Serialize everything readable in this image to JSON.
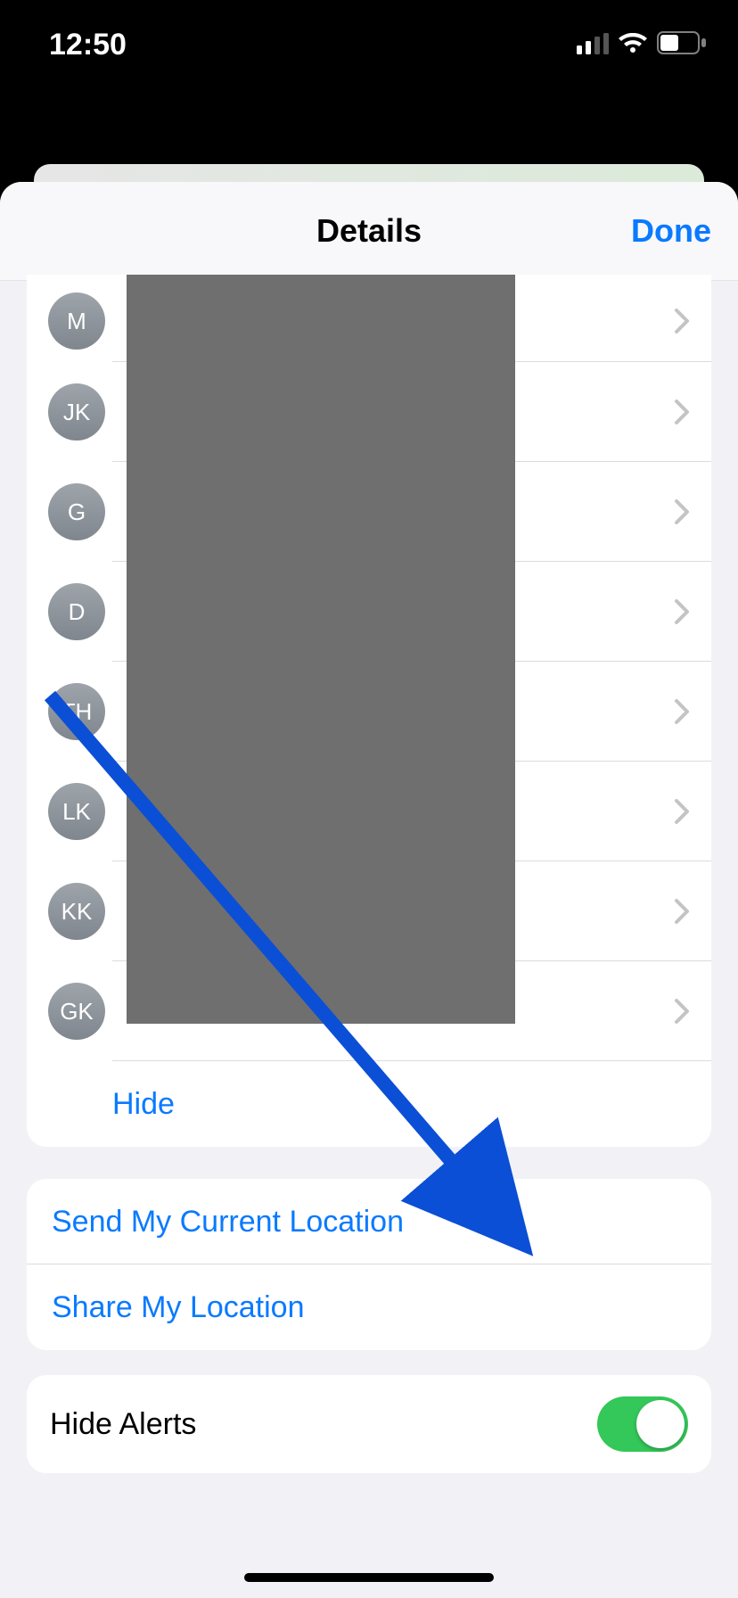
{
  "statusbar": {
    "time": "12:50"
  },
  "nav": {
    "title": "Details",
    "done": "Done"
  },
  "participants": [
    {
      "initials": "M"
    },
    {
      "initials": "JK"
    },
    {
      "initials": "G"
    },
    {
      "initials": "D"
    },
    {
      "initials": "TH"
    },
    {
      "initials": "LK"
    },
    {
      "initials": "KK"
    },
    {
      "initials": "GK"
    }
  ],
  "actions": {
    "hide": "Hide",
    "send_location": "Send My Current Location",
    "share_location": "Share My Location"
  },
  "settings": {
    "hide_alerts_label": "Hide Alerts",
    "hide_alerts_on": true
  }
}
